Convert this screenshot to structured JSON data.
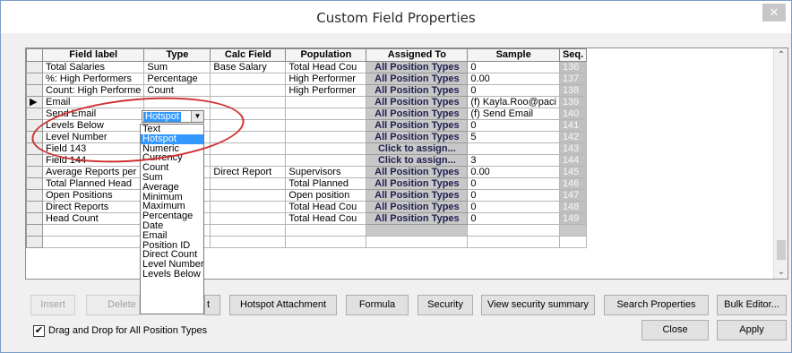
{
  "window": {
    "title": "Custom Field Properties",
    "close_glyph": "✕"
  },
  "grid": {
    "columns": [
      "",
      "Field label",
      "Type",
      "Calc Field",
      "Population",
      "Assigned To",
      "Sample",
      "Seq."
    ],
    "rows": [
      {
        "label": "Total Salaries",
        "type": "Sum",
        "calc": "Base Salary",
        "pop": "Total Head Cou",
        "assigned": "All Position Types",
        "sample": "0",
        "seq": "136"
      },
      {
        "label": "%: High Performers",
        "type": "Percentage",
        "calc": "",
        "pop": "High Performer",
        "assigned": "All Position Types",
        "sample": "0.00",
        "seq": "137"
      },
      {
        "label": "Count: High Performe",
        "type": "Count",
        "calc": "",
        "pop": "High Performer",
        "assigned": "All Position Types",
        "sample": "0",
        "seq": "138"
      },
      {
        "label": "Email",
        "type": "",
        "calc": "",
        "pop": "",
        "assigned": "All Position Types",
        "sample": "(f) Kayla.Roo@paci",
        "seq": "139"
      },
      {
        "label": "Send Email",
        "type": "",
        "calc": "",
        "pop": "",
        "assigned": "All Position Types",
        "sample": "(f) Send Email",
        "seq": "140"
      },
      {
        "label": "Levels Below",
        "type": "",
        "calc": "",
        "pop": "",
        "assigned": "All Position Types",
        "sample": "0",
        "seq": "141"
      },
      {
        "label": "Level Number",
        "type": "",
        "calc": "",
        "pop": "",
        "assigned": "All Position Types",
        "sample": "5",
        "seq": "142"
      },
      {
        "label": "Field 143",
        "type": "",
        "calc": "",
        "pop": "",
        "assigned": "Click to assign...",
        "sample": "",
        "seq": "143"
      },
      {
        "label": "Field 144",
        "type": "",
        "calc": "",
        "pop": "",
        "assigned": "Click to assign...",
        "sample": "3",
        "seq": "144"
      },
      {
        "label": "Average Reports per",
        "type": "",
        "calc": "Direct Report",
        "pop": "Supervisors",
        "assigned": "All Position Types",
        "sample": "0.00",
        "seq": "145"
      },
      {
        "label": "Total Planned Head",
        "type": "",
        "calc": "",
        "pop": "Total Planned",
        "assigned": "All Position Types",
        "sample": "0",
        "seq": "146"
      },
      {
        "label": "Open Positions",
        "type": "",
        "calc": "",
        "pop": "Open position",
        "assigned": "All Position Types",
        "sample": "0",
        "seq": "147"
      },
      {
        "label": "Direct Reports",
        "type": "",
        "calc": "",
        "pop": "Total Head Cou",
        "assigned": "All Position Types",
        "sample": "0",
        "seq": "148"
      },
      {
        "label": "Head Count",
        "type": "",
        "calc": "",
        "pop": "Total Head Cou",
        "assigned": "All Position Types",
        "sample": "0",
        "seq": "149"
      }
    ],
    "current_row_marker": "▶"
  },
  "type_dropdown": {
    "value": "Hotspot",
    "options": [
      "Text",
      "Hotspot",
      "Numeric",
      "Currency",
      "Count",
      "Sum",
      "Average",
      "Minimum",
      "Maximum",
      "Percentage",
      "Date",
      "Email",
      "Position ID",
      "Direct Count",
      "Level Number",
      "Levels Below"
    ],
    "highlighted": "Hotspot"
  },
  "buttons": {
    "insert": "Insert",
    "delete": "Delete",
    "attach_partial": "t",
    "hotspot_attachment": "Hotspot Attachment",
    "formula": "Formula",
    "security": "Security",
    "view_security_summary": "View security summary",
    "search_properties": "Search Properties",
    "bulk_editor": "Bulk Editor...",
    "close": "Close",
    "apply": "Apply"
  },
  "drag_drop": {
    "label": "Drag and Drop for All Position Types",
    "checked": true,
    "check_glyph": "✔"
  },
  "colors": {
    "highlight": "#3399ff",
    "annotation": "#d03030"
  }
}
